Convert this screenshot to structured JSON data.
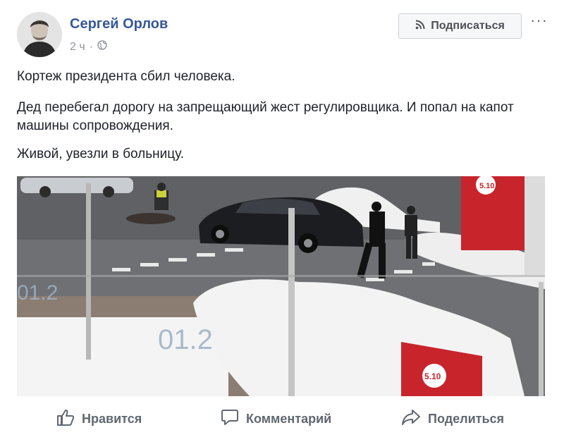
{
  "post": {
    "author": "Сергей Орлов",
    "time": "2 ч",
    "time_separator": "·",
    "privacy_icon": "globe-icon",
    "subscribe_label": "Подписаться",
    "subscribe_icon": "rss-icon",
    "more_label": "···",
    "paragraphs": [
      "Кортеж президента сбил человека.",
      "Дед перебегал дорогу на запрещающий жест регулировщика. И попал на капот машины сопровождения.",
      "Живой, увезли в больницу."
    ],
    "photo": {
      "overlay_texts": [
        "01.2",
        "01.2",
        "5.10",
        "5.10"
      ]
    }
  },
  "actions": {
    "like_label": "Нравится",
    "comment_label": "Комментарий",
    "share_label": "Поделиться"
  },
  "colors": {
    "author": "#365899",
    "muted": "#90949c",
    "action": "#606770"
  }
}
